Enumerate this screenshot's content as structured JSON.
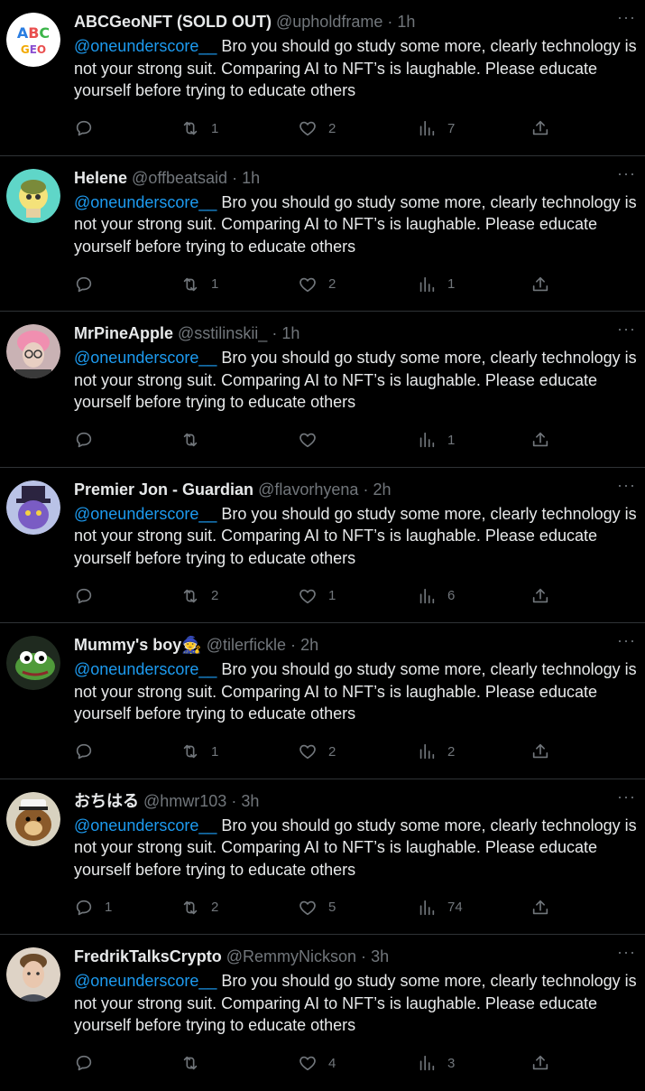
{
  "tweets": [
    {
      "name": "ABCGeoNFT (SOLD OUT)",
      "handle": "@upholdframe",
      "time": "1h",
      "mention": "@oneunderscore__",
      "text": " Bro you should go study some more, clearly technology is not your strong suit. Comparing AI to NFT’s is laughable. Please educate yourself before trying to educate others",
      "replies": "",
      "retweets": "1",
      "likes": "2",
      "views": "7",
      "avatar_color": "#ffffff",
      "avatar_text": "ABC"
    },
    {
      "name": "Helene",
      "handle": "@offbeatsaid",
      "time": "1h",
      "mention": "@oneunderscore__",
      "text": " Bro you should go study some more, clearly technology is not your strong suit. Comparing AI to NFT’s is laughable. Please educate yourself before trying to educate others",
      "replies": "",
      "retweets": "1",
      "likes": "2",
      "views": "1",
      "avatar_color": "#5fd6c8"
    },
    {
      "name": "MrPineApple",
      "handle": "@sstilinskii_",
      "time": "1h",
      "mention": "@oneunderscore__",
      "text": " Bro you should go study some more, clearly technology is not your strong suit. Comparing AI to NFT’s is laughable. Please educate yourself before trying to educate others",
      "replies": "",
      "retweets": "",
      "likes": "",
      "views": "1",
      "avatar_color": "#c9b2b4"
    },
    {
      "name": "Premier Jon - Guardian",
      "handle": "@flavorhyena",
      "time": "2h",
      "mention": "@oneunderscore__",
      "text": " Bro you should go study some more, clearly technology is not your strong suit. Comparing AI to NFT’s is laughable. Please educate yourself before trying to educate others",
      "replies": "",
      "retweets": "2",
      "likes": "1",
      "views": "6",
      "avatar_color": "#6b4fa0"
    },
    {
      "name": "Mummy's boy🧙",
      "handle": "@tilerfickle",
      "time": "2h",
      "mention": "@oneunderscore__",
      "text": " Bro you should go study some more, clearly technology is not your strong suit. Comparing AI to NFT’s is laughable. Please educate yourself before trying to educate others",
      "replies": "",
      "retweets": "1",
      "likes": "2",
      "views": "2",
      "avatar_color": "#2a3a2a"
    },
    {
      "name": "おちはる",
      "handle": "@hmwr103",
      "time": "3h",
      "mention": "@oneunderscore__",
      "text": " Bro you should go study some more, clearly technology is not your strong suit. Comparing AI to NFT’s is laughable. Please educate yourself before trying to educate others",
      "replies": "1",
      "retweets": "2",
      "likes": "5",
      "views": "74",
      "avatar_color": "#6b5a3a"
    },
    {
      "name": "FredrikTalksCrypto",
      "handle": "@RemmyNickson",
      "time": "3h",
      "mention": "@oneunderscore__",
      "text": " Bro you should go study some more, clearly technology is not your strong suit. Comparing AI to NFT’s is laughable. Please educate yourself before trying to educate others",
      "replies": "",
      "retweets": "",
      "likes": "4",
      "views": "3",
      "avatar_color": "#d9c3ad"
    }
  ]
}
